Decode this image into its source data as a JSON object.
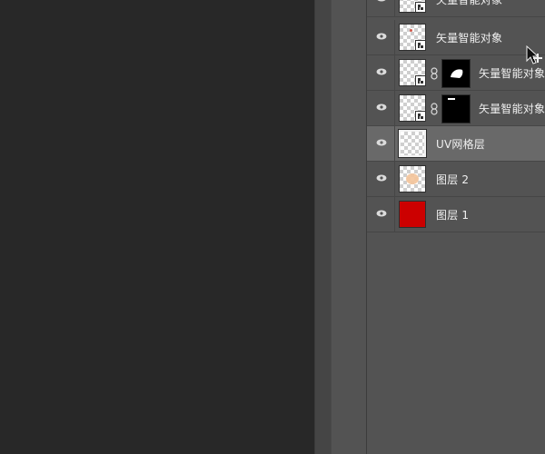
{
  "layers_panel": {
    "layers": [
      {
        "name": "矢量智能对象",
        "type": "smart-object",
        "mask": null
      },
      {
        "name": "矢量智能对象",
        "type": "smart-object",
        "mask": null
      },
      {
        "name": "矢量智能对象",
        "type": "smart-object",
        "mask": "soft-white-shape"
      },
      {
        "name": "矢量智能对象",
        "type": "smart-object",
        "mask": "small-white-bar"
      },
      {
        "name": "UV网格层",
        "type": "pixel",
        "selected": true
      },
      {
        "name": "图层 2",
        "type": "pixel",
        "thumb_color": "#f4c49a"
      },
      {
        "name": "图层 1",
        "type": "pixel",
        "thumb_color": "#cc0000"
      }
    ]
  },
  "colors": {
    "canvas_bg": "#282828",
    "panel_bg": "#535353",
    "selected_row": "#696969",
    "layer1_fill": "#cc0000"
  }
}
